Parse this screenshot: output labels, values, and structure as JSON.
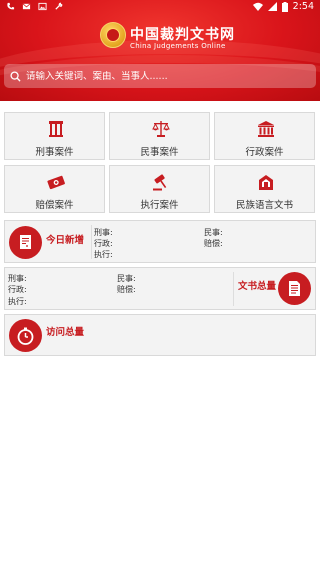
{
  "status_bar": {
    "time": "2:54",
    "left_icons": [
      "phone-icon",
      "email-icon",
      "image-icon",
      "wrench-icon"
    ],
    "right_icons": [
      "wifi-icon",
      "signal-icon",
      "battery-icon"
    ]
  },
  "header": {
    "title": "中国裁判文书网",
    "subtitle": "China Judgements Online",
    "logo": "court-emblem-icon"
  },
  "search": {
    "placeholder": "请输入关键词、案由、当事人......",
    "icon": "search-icon"
  },
  "categories": [
    {
      "label": "刑事案件",
      "icon": "prison-bars-icon"
    },
    {
      "label": "民事案件",
      "icon": "scales-icon"
    },
    {
      "label": "行政案件",
      "icon": "courthouse-icon"
    },
    {
      "label": "赔偿案件",
      "icon": "money-icon"
    },
    {
      "label": "执行案件",
      "icon": "gavel-icon"
    },
    {
      "label": "民族语言文书",
      "icon": "ethnic-document-icon"
    }
  ],
  "today_new": {
    "title": "今日新增",
    "icon": "document-add-icon",
    "criminal": "刑事:",
    "civil": "民事:",
    "administrative": "行政:",
    "compensation": "赔偿:",
    "enforcement": "执行:"
  },
  "documents_total": {
    "title": "文书总量",
    "icon": "document-icon",
    "criminal": "刑事:",
    "civil": "民事:",
    "administrative": "行政:",
    "compensation": "赔偿:",
    "enforcement": "执行:"
  },
  "visits_total": {
    "title": "访问总量",
    "icon": "stopwatch-icon"
  },
  "colors": {
    "brand_red": "#c71d21",
    "header_red": "#d9141a",
    "panel_bg": "#f3f3f3"
  }
}
